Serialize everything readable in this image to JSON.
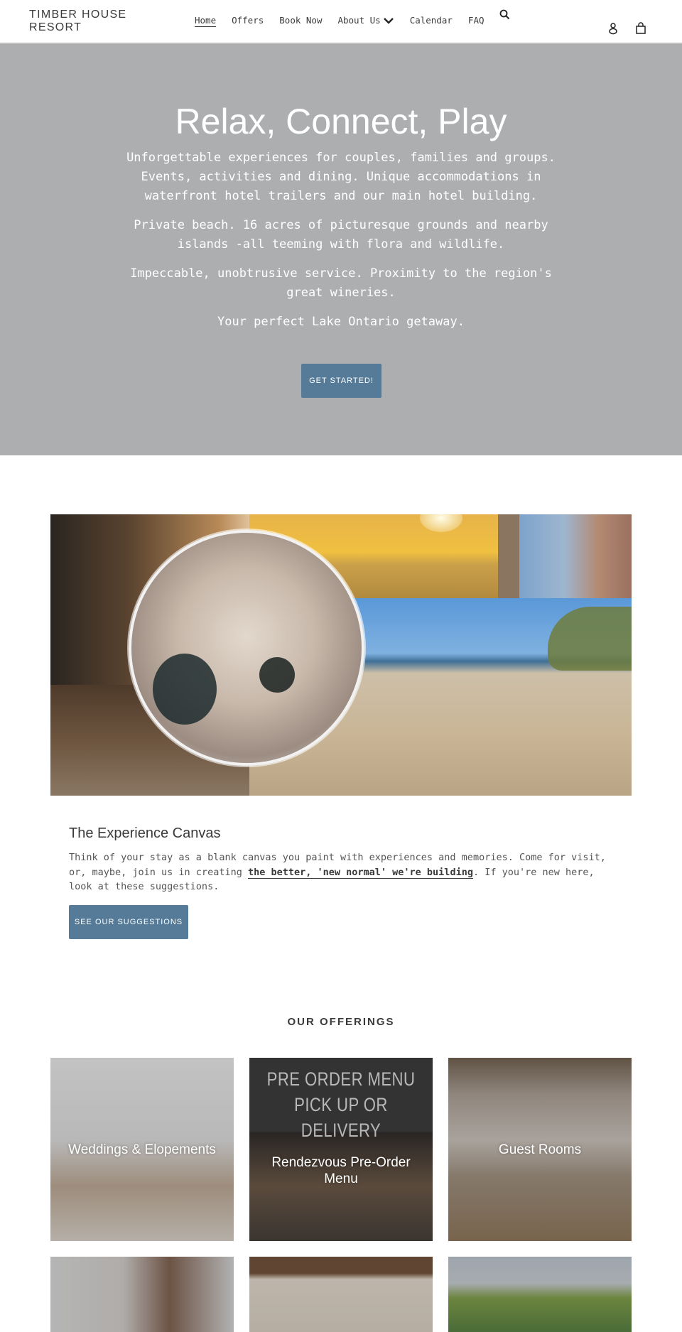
{
  "header": {
    "logo": "TIMBER HOUSE RESORT",
    "nav": [
      {
        "label": "Home",
        "active": true
      },
      {
        "label": "Offers"
      },
      {
        "label": "Book Now"
      },
      {
        "label": "About Us",
        "has_dropdown": true
      },
      {
        "label": "Calendar"
      },
      {
        "label": "FAQ"
      }
    ],
    "icons": {
      "search": "search-icon",
      "account": "account-icon",
      "cart": "cart-icon"
    }
  },
  "hero": {
    "title": "Relax, Connect, Play",
    "paragraphs": [
      "Unforgettable experiences for couples, families and groups. Events, activities and dining. Unique accommodations in waterfront hotel trailers and our main hotel building.",
      "Private beach. 16 acres of picturesque grounds and nearby islands -all teeming with flora and wildlife.",
      "Impeccable, unobtrusive service. Proximity to the region's great wineries.",
      "Your perfect Lake Ontario getaway."
    ],
    "button": "GET STARTED!",
    "bg_color": "#adaeb0"
  },
  "experience": {
    "title": "The Experience Canvas",
    "text_before": "Think of your stay as a blank canvas you paint with experiences and memories. Come for visit, or, maybe, join us in creating ",
    "link": "the better, 'new normal' we're building",
    "text_after": ". If you're new here, look at these suggestions.",
    "button": "SEE OUR SUGGESTIONS"
  },
  "offerings": {
    "title": "OUR OFFERINGS",
    "tiles": [
      {
        "label": "Weddings & Elopements"
      },
      {
        "label": "Rendezvous Pre-Order Menu",
        "promo_line1": "PRE ORDER MENU",
        "promo_line2": "PICK UP OR DELIVERY"
      },
      {
        "label": "Guest Rooms"
      },
      {
        "label": ""
      },
      {
        "label": ""
      },
      {
        "label": ""
      }
    ]
  },
  "colors": {
    "accent": "#557b98",
    "text": "#3a3a3a"
  }
}
